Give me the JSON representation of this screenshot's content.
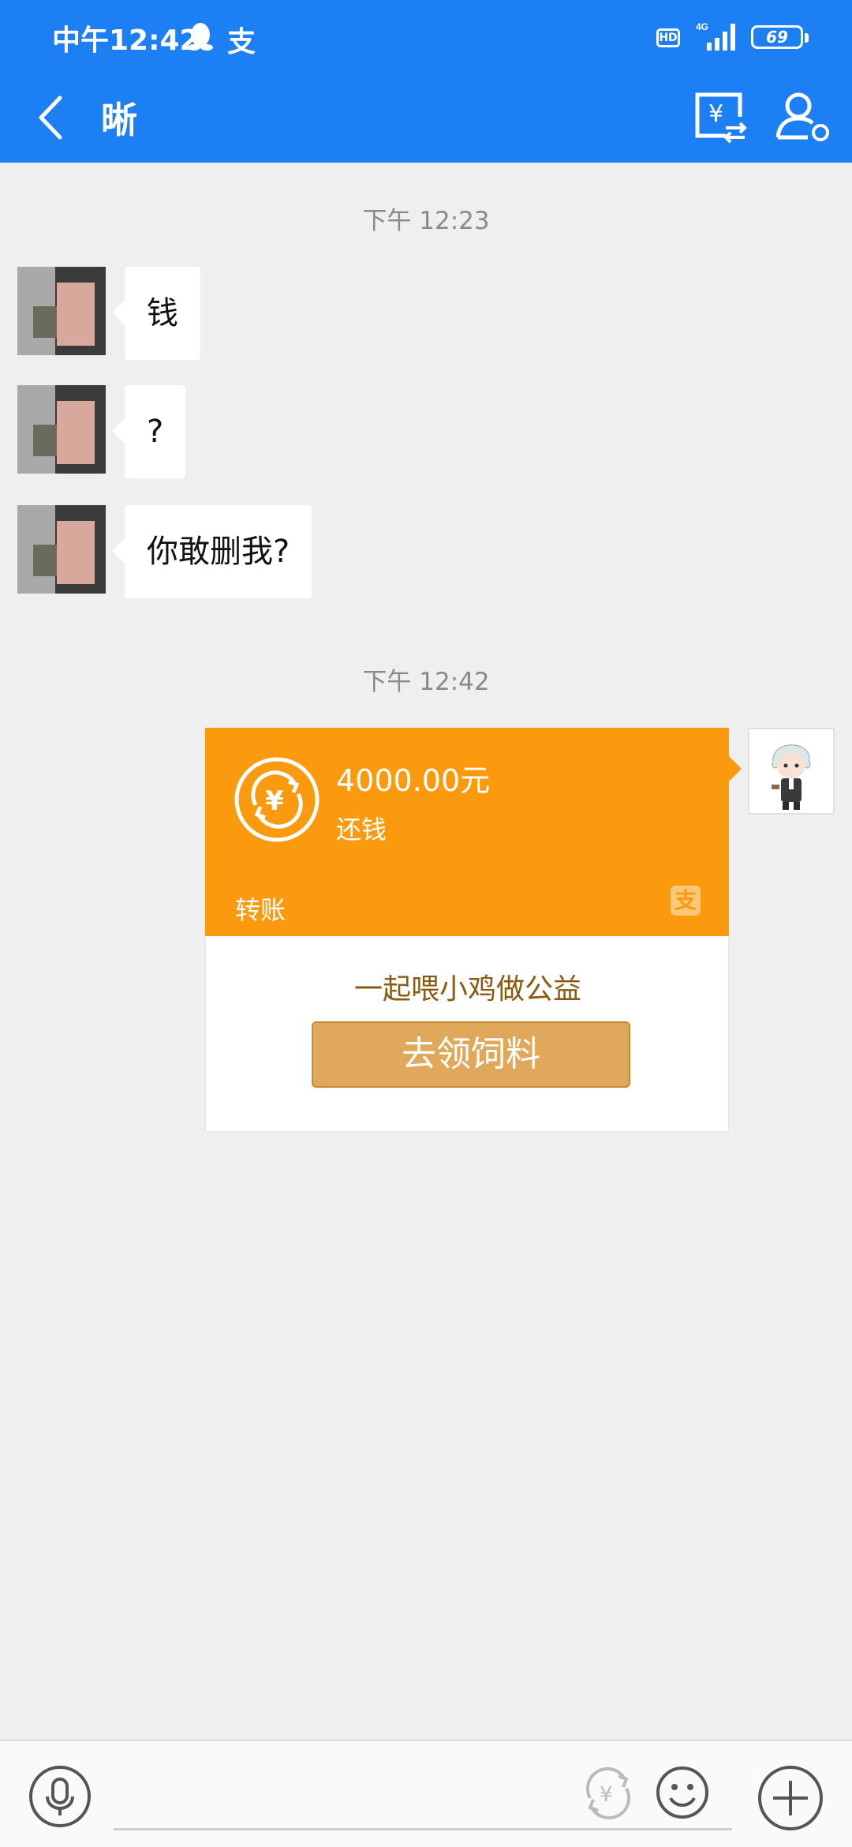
{
  "status_bar": {
    "time": "中午12:42",
    "network": "4G",
    "hd": "HD",
    "battery": "69"
  },
  "header": {
    "title": "晰"
  },
  "chat": {
    "timestamp_1": "下午 12:23",
    "messages_in": [
      {
        "text": "钱"
      },
      {
        "text": "?"
      },
      {
        "text": "你敢删我?"
      }
    ],
    "timestamp_2": "下午 12:42",
    "transfer": {
      "amount": "4000.00元",
      "memo": "还钱",
      "type_label": "转账",
      "badge": "支",
      "promo_text": "一起喂小鸡做公益",
      "claim_button": "去领饲料"
    }
  },
  "colors": {
    "header_blue": "#1c7ff4",
    "transfer_orange": "#fb9a0e",
    "claim_button": "#e0a85a"
  }
}
